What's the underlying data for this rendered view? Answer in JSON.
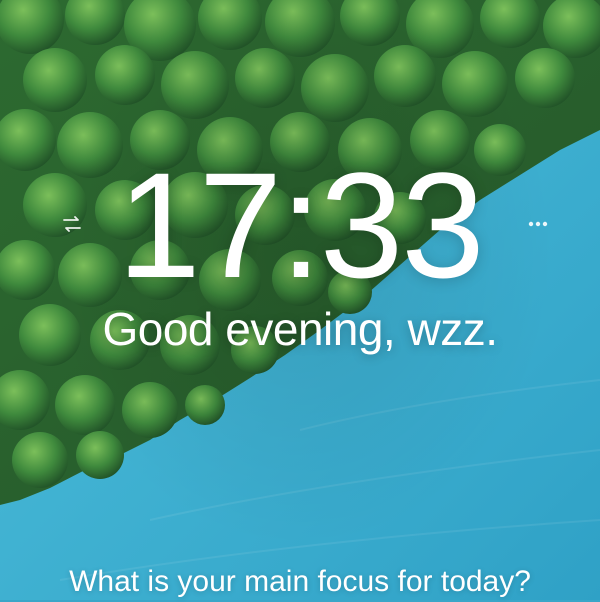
{
  "clock": {
    "time": "17:33"
  },
  "greeting": {
    "text": "Good evening, wzz."
  },
  "focus": {
    "question": "What is your main focus for today?"
  },
  "icons": {
    "left": "swap-arrows-icon",
    "right": "more-dots-icon"
  },
  "colors": {
    "text": "#ffffff",
    "water": "#3ab0d3",
    "forest": "#2f6b34"
  }
}
